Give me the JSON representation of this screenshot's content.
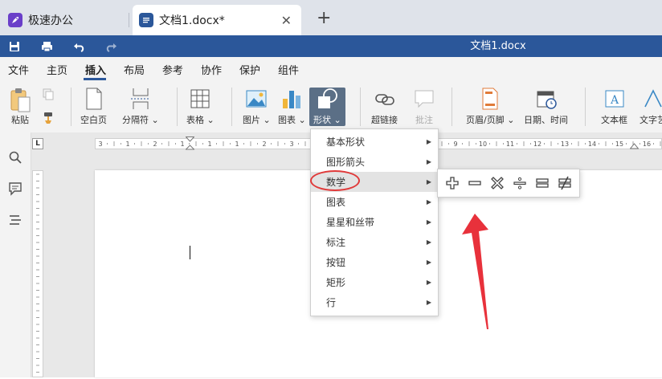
{
  "tabs": [
    {
      "title": "极速办公",
      "icon": "rocket-icon",
      "color": "#6a3fc9"
    },
    {
      "title": "文档1.docx*",
      "icon": "doc-icon",
      "color": "#2b579a"
    }
  ],
  "window": {
    "title": "文档1.docx"
  },
  "menus": [
    "文件",
    "主页",
    "插入",
    "布局",
    "参考",
    "协作",
    "保护",
    "组件"
  ],
  "ribbon": {
    "paste": "粘贴",
    "blank_page": "空白页",
    "separator": "分隔符",
    "table": "表格",
    "picture": "图片",
    "chart": "图表",
    "shape": "形状",
    "hyperlink": "超链接",
    "comment": "批注",
    "header_footer": "页眉/页脚",
    "datetime": "日期、时间",
    "textbox": "文本框",
    "textart": "文字艺"
  },
  "shape_menu": {
    "items": [
      "基本形状",
      "图形箭头",
      "数学",
      "图表",
      "星星和丝带",
      "标注",
      "按钮",
      "矩形",
      "行"
    ],
    "active": "数学"
  },
  "math_submenu": [
    "plus-shape-icon",
    "minus-shape-icon",
    "multiply-shape-icon",
    "divide-shape-icon",
    "equal-shape-icon",
    "not-equal-shape-icon"
  ],
  "ruler": {
    "h_labels": [
      "3",
      "1",
      "2",
      "1",
      "1",
      "1",
      "2",
      "3",
      "4",
      "5",
      "6",
      "7",
      "8",
      "9",
      "10",
      "11",
      "12",
      "13",
      "14",
      "15",
      "16"
    ]
  },
  "colors": {
    "accent": "#2b579a",
    "annotation": "#e03a3a",
    "active_item": "#e3e3e3"
  }
}
